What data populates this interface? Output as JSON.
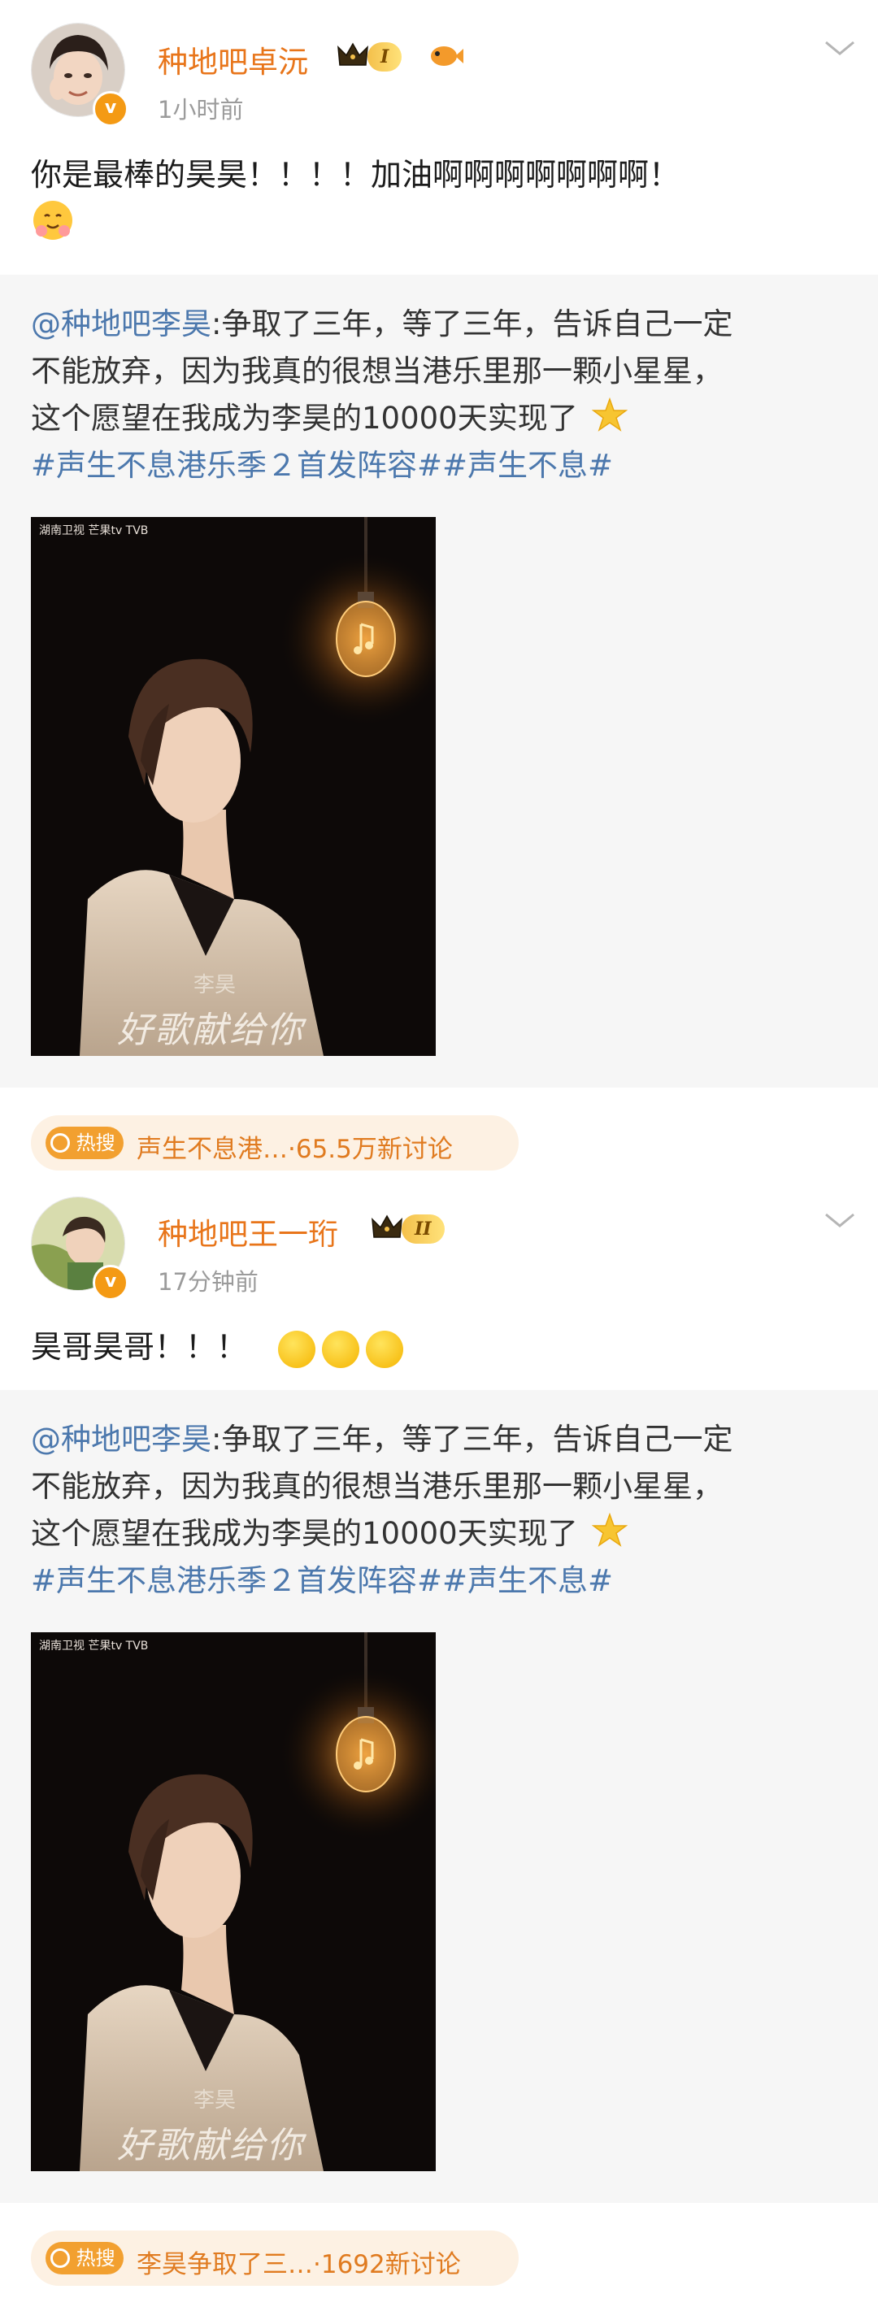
{
  "posts": [
    {
      "username": "种地吧卓沅",
      "level": "I",
      "timestamp": "1小时前",
      "text": "你是最棒的昊昊！！！！加油啊啊啊啊啊啊啊！",
      "repost": {
        "mention": "@种地吧李昊",
        "line1_rest": ":争取了三年，等了三年，告诉自己一定",
        "line2": "不能放弃，因为我真的很想当港乐里那一颗小星星，",
        "line3": "这个愿望在我成为李昊的10000天实现了",
        "tags": "#声生不息港乐季２首发阵容##声生不息#",
        "poster": {
          "channel_labels": "湖南卫视 芒果tv TVB",
          "name": "李昊",
          "slogan": "好歌献给你"
        }
      },
      "hot_search": {
        "badge": "热搜",
        "text": "声生不息港…·65.5万新讨论"
      }
    },
    {
      "username": "种地吧王一珩",
      "level": "II",
      "timestamp": "17分钟前",
      "text": "昊哥昊哥！！！",
      "repost": {
        "mention": "@种地吧李昊",
        "line1_rest": ":争取了三年，等了三年，告诉自己一定",
        "line2": "不能放弃，因为我真的很想当港乐里那一颗小星星，",
        "line3": "这个愿望在我成为李昊的10000天实现了",
        "tags": "#声生不息港乐季２首发阵容##声生不息#",
        "poster": {
          "channel_labels": "湖南卫视 芒果tv TVB",
          "name": "李昊",
          "slogan": "好歌献给你"
        }
      },
      "hot_search": {
        "badge": "热搜",
        "text": "李昊争取了三…·1692新讨论"
      }
    }
  ],
  "icons": {
    "verified": "v-badge-icon",
    "crown": "crown-icon",
    "more": "chevron-down-icon",
    "sparkle": "sparkle-star-icon",
    "fire": "hot-search-icon"
  },
  "colors": {
    "username": "#e8751a",
    "link": "#4c78ad",
    "repost_bg": "#f6f6f6",
    "hot_bg": "#fdf1e3",
    "verified": "#f49a14"
  }
}
